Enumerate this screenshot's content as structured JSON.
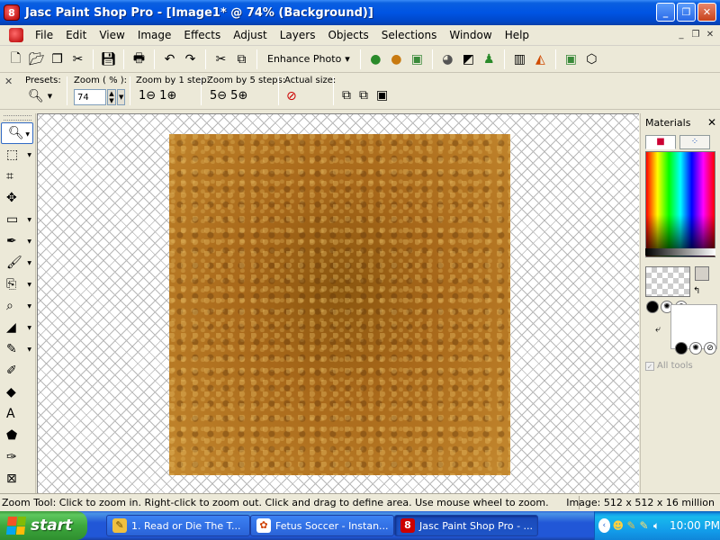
{
  "window": {
    "title": "Jasc Paint Shop Pro - [Image1* @  74% (Background)]",
    "app_icon": "paintshop-icon",
    "minimize": "_",
    "maximize": "❐",
    "close": "✕"
  },
  "menu": {
    "items": [
      "File",
      "Edit",
      "View",
      "Image",
      "Effects",
      "Adjust",
      "Layers",
      "Objects",
      "Selections",
      "Window",
      "Help"
    ],
    "mdi_minimize": "_",
    "mdi_restore": "❐",
    "mdi_close": "✕"
  },
  "toolbar": {
    "enhance_photo": "Enhance Photo",
    "enhance_arrow": "▾"
  },
  "tool_options": {
    "close": "✕",
    "presets_label": "Presets:",
    "zoom_label": "Zoom ( % ):",
    "zoom_value": "74",
    "zoom_step1_label": "Zoom by 1 step:",
    "zoom_step5_label": "Zoom by 5 steps:",
    "actual_size_label": "Actual size:"
  },
  "tools": {
    "items": [
      {
        "name": "zoom-tool",
        "glyph": "🔍︎",
        "active": true
      },
      {
        "name": "selection-tool",
        "glyph": "⬚"
      },
      {
        "name": "crop-tool",
        "glyph": "⌗"
      },
      {
        "name": "move-tool",
        "glyph": "✥"
      },
      {
        "name": "marquee-tool",
        "glyph": "▭"
      },
      {
        "name": "dropper-tool",
        "glyph": "✒"
      },
      {
        "name": "paint-brush-tool",
        "glyph": "🖌︎"
      },
      {
        "name": "clone-tool",
        "glyph": "⎘"
      },
      {
        "name": "retouch-tool",
        "glyph": "⌕"
      },
      {
        "name": "eraser-tool",
        "glyph": "◢"
      },
      {
        "name": "color-replacer-tool",
        "glyph": "✎"
      },
      {
        "name": "picture-tube-tool",
        "glyph": "✐"
      },
      {
        "name": "fill-tool",
        "glyph": "◆"
      },
      {
        "name": "text-tool",
        "glyph": "A"
      },
      {
        "name": "shape-tool",
        "glyph": "⬟"
      },
      {
        "name": "pen-tool",
        "glyph": "✑"
      },
      {
        "name": "warp-tool",
        "glyph": "⊠"
      }
    ]
  },
  "materials": {
    "title": "Materials",
    "close": "✕",
    "all_tools_label": "All tools",
    "all_tools_checked": "✓"
  },
  "statusbar": {
    "message": "Zoom Tool: Click to zoom in. Right-click to zoom out. Click and drag to define area. Use mouse wheel to zoom.",
    "image_info": "Image:  512 x 512 x 16 million"
  },
  "taskbar": {
    "start_label": "start",
    "tasks": [
      {
        "label": "1. Read or Die The T...",
        "icon": "pencil-icon",
        "active": false
      },
      {
        "label": "Fetus Soccer - Instan...",
        "icon": "messenger-icon",
        "active": false
      },
      {
        "label": "Jasc Paint Shop Pro - ...",
        "icon": "paintshop-icon",
        "active": true
      }
    ],
    "clock": "10:00 PM",
    "tray_arrow": "‹"
  },
  "colors": {
    "title_bar": "#0054e3",
    "taskbar": "#2157d7",
    "start_button": "#3da83d",
    "canvas_texture": "#a8681a"
  }
}
